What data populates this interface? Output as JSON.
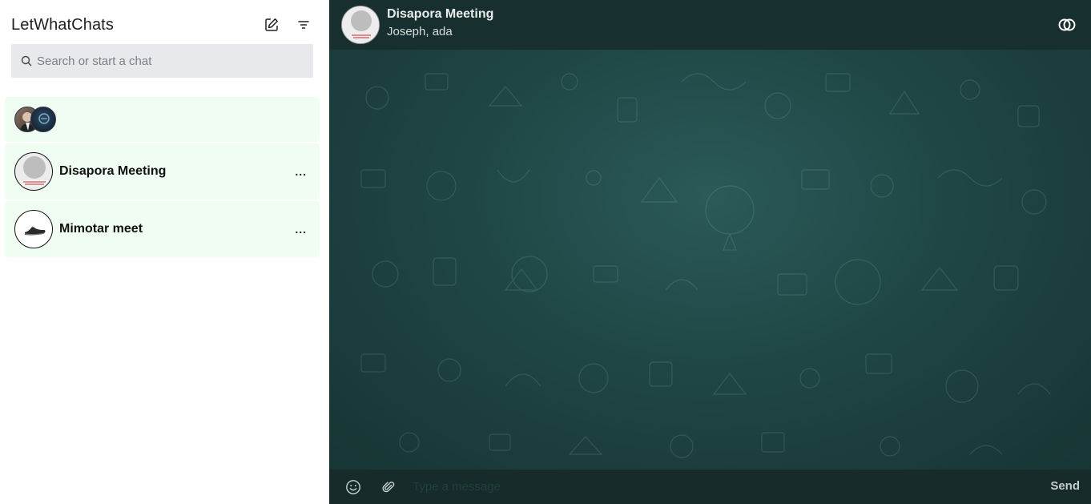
{
  "sidebar": {
    "app_title": "LetWhatChats",
    "icons": {
      "compose": "compose-icon",
      "filter": "filter-icon",
      "search": "search-icon"
    },
    "search": {
      "placeholder": "Search or start a chat",
      "value": ""
    },
    "chats": [
      {
        "name": "",
        "type": "group-avatars"
      },
      {
        "name": "Disapora Meeting",
        "menu": "..."
      },
      {
        "name": "Mimotar meet",
        "menu": "..."
      }
    ]
  },
  "main": {
    "header": {
      "title": "Disapora Meeting",
      "subtitle": "Joseph, ada"
    },
    "composer": {
      "placeholder": "Type a message",
      "value": "",
      "send_label": "Send"
    }
  },
  "colors": {
    "sidebar_bg": "#ffffff",
    "chat_item_bg": "#effdf3",
    "search_bg": "#e8e9ec",
    "topbar_bg": "#17302f",
    "wallpaper": "#1f4645",
    "composer_bg": "#162b2a"
  }
}
